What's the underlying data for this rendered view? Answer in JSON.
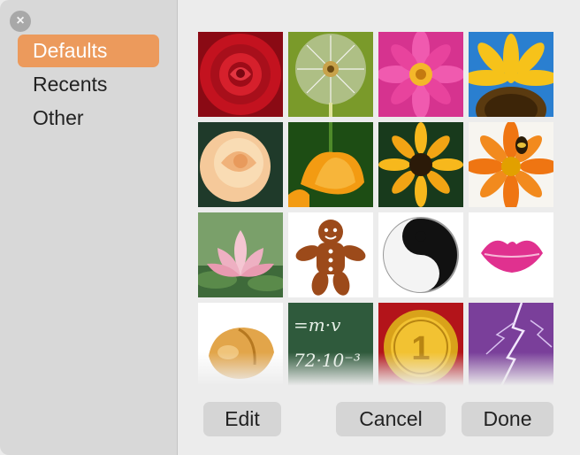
{
  "sidebar": {
    "close_icon": "×",
    "items": [
      {
        "label": "Defaults",
        "selected": true
      },
      {
        "label": "Recents",
        "selected": false
      },
      {
        "label": "Other",
        "selected": false
      }
    ]
  },
  "grid": {
    "images": [
      "red-rose",
      "dandelion",
      "pink-dahlia",
      "sunflower",
      "peach-rose",
      "orange-poppy",
      "black-eyed-susan",
      "orange-gerbera-with-bee",
      "lotus",
      "gingerbread-man",
      "yin-yang",
      "lips",
      "fortune-cookie",
      "chalkboard",
      "gold-medal",
      "lightning"
    ],
    "chalkboard_text": [
      "=m·v",
      "72·10⁻³"
    ],
    "medal_text": "1"
  },
  "buttons": {
    "edit": "Edit",
    "cancel": "Cancel",
    "done": "Done"
  },
  "colors": {
    "selection": "#ec9a5c",
    "sidebar_bg": "#d8d8d8",
    "window_bg": "#ececec",
    "button_bg": "#d5d5d5"
  }
}
